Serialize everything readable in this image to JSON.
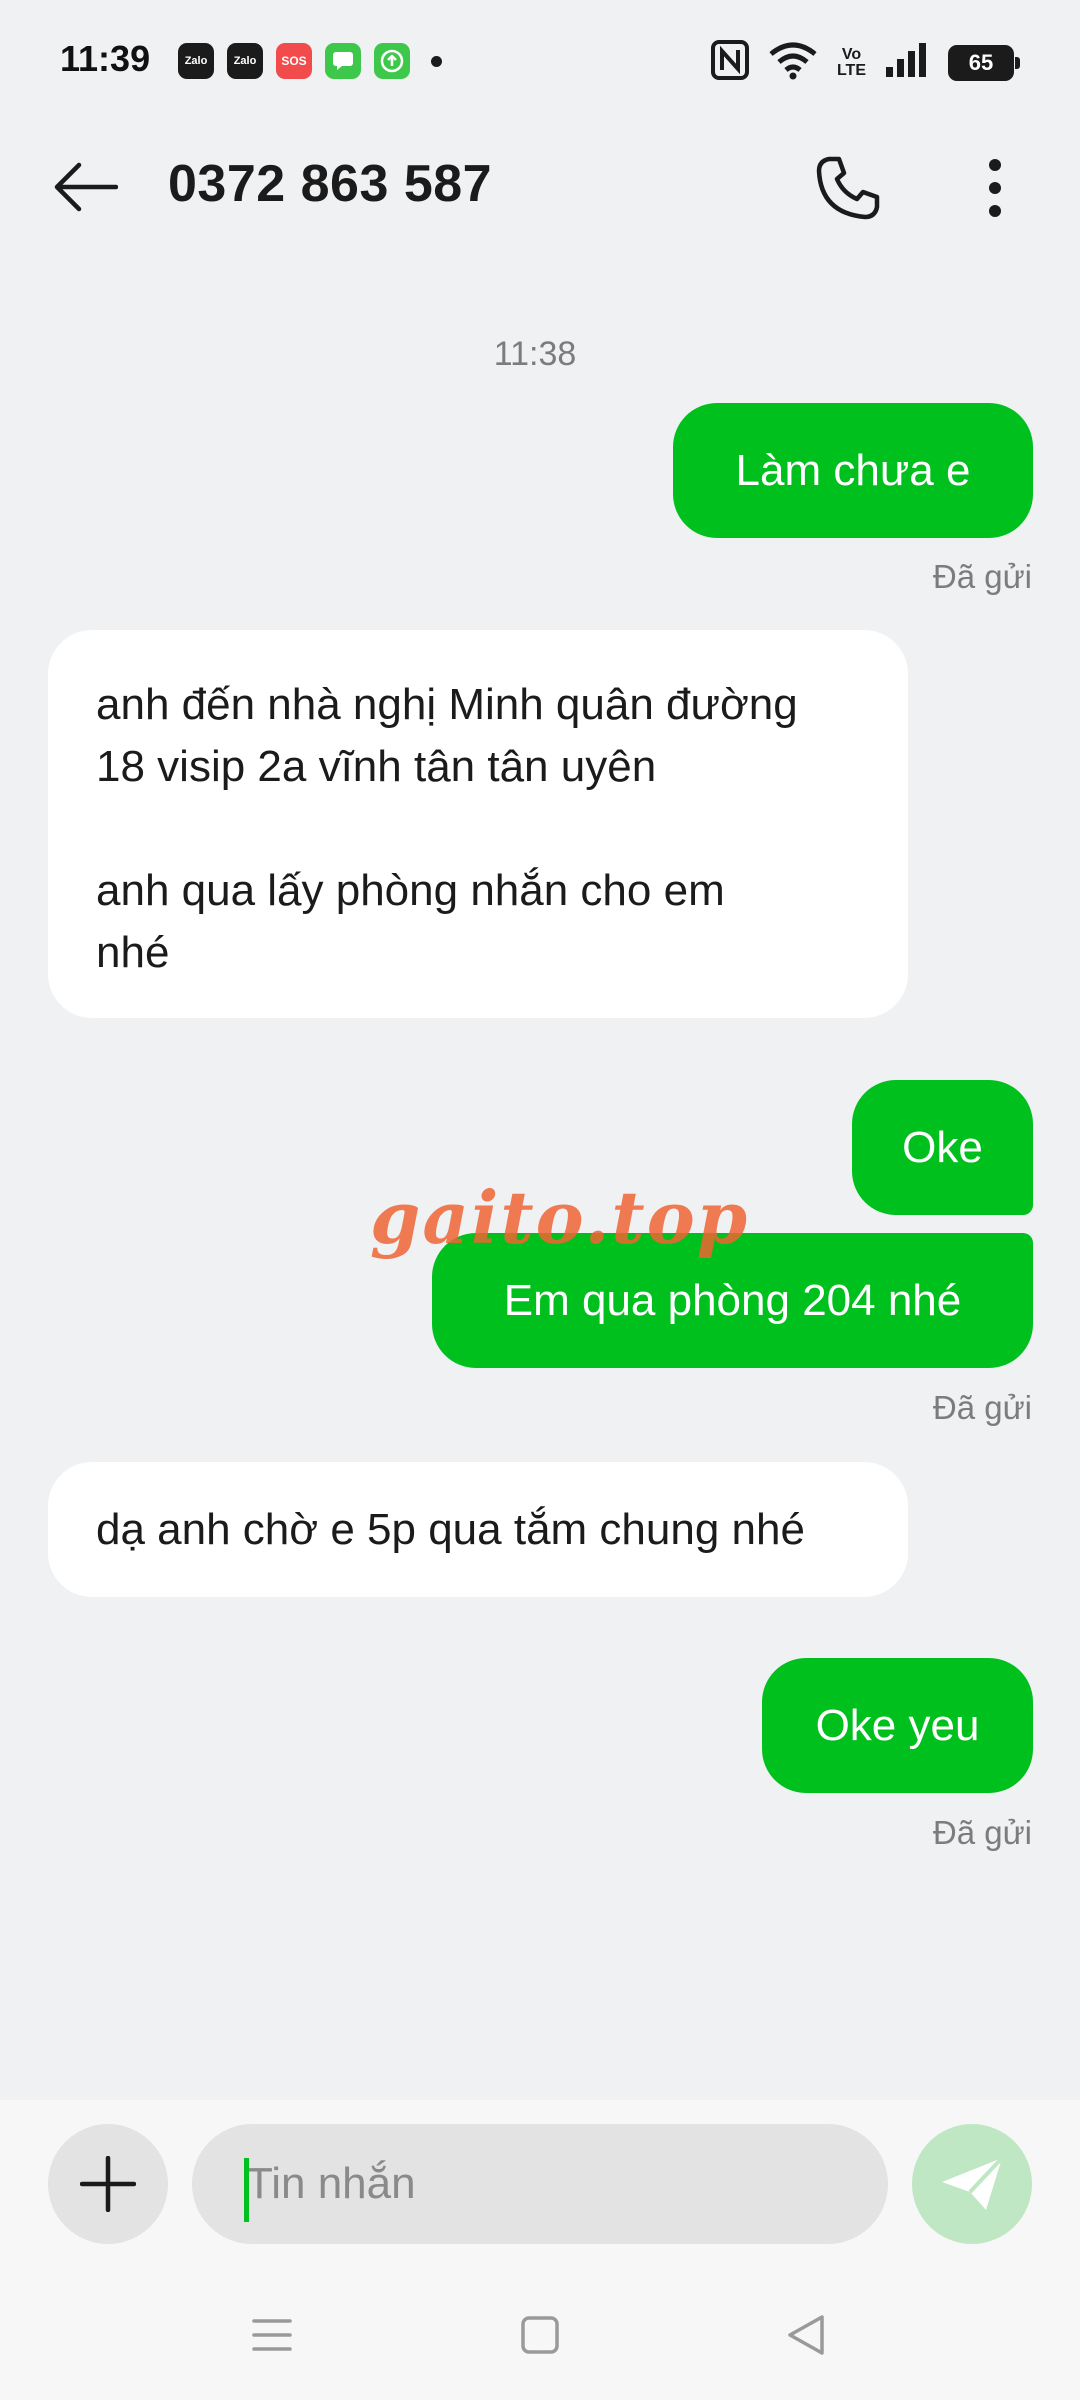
{
  "status_bar": {
    "time": "11:39",
    "notification_icons": [
      {
        "name": "zalo-icon",
        "label": "Zalo"
      },
      {
        "name": "zalo-icon",
        "label": "Zalo"
      },
      {
        "name": "sos-icon",
        "label": "SOS"
      },
      {
        "name": "message-app-icon",
        "label": ""
      },
      {
        "name": "upload-icon",
        "label": ""
      }
    ],
    "volte_label_1": "Vo",
    "volte_label_2": "LTE",
    "battery": "65"
  },
  "header": {
    "title": "0372 863 587"
  },
  "conversation": {
    "timestamp": "11:38",
    "messages": [
      {
        "direction": "out",
        "text": "Làm chưa e",
        "status": "Đã gửi"
      },
      {
        "direction": "in",
        "lines": [
          "anh đến nhà nghị Minh quân đường",
          "18 visip 2a vĩnh tân tân uyên",
          "",
          "anh qua lấy phòng nhắn cho em",
          "nhé"
        ]
      },
      {
        "direction": "out",
        "text": "Oke"
      },
      {
        "direction": "out",
        "text": "Em qua phòng 204 nhé",
        "status": "Đã gửi"
      },
      {
        "direction": "in",
        "text": "dạ anh chờ e 5p qua tắm chung nhé"
      },
      {
        "direction": "out",
        "text": "Oke yeu",
        "status": "Đã gửi"
      }
    ]
  },
  "watermark": "gaito.top",
  "composer": {
    "placeholder": "Tin nhắn"
  },
  "colors": {
    "outgoing_bubble": "#00c01e",
    "incoming_bubble": "#ffffff",
    "background": "#f0f1f3"
  }
}
